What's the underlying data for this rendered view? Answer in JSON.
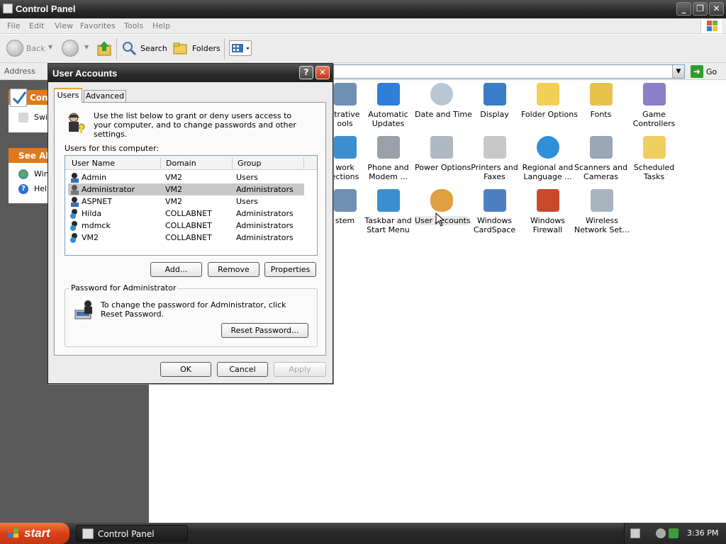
{
  "window": {
    "title": "Control Panel",
    "controls": {
      "minimize": "_",
      "restore": "❐",
      "close": "✕"
    }
  },
  "menubar": [
    "File",
    "Edit",
    "View",
    "Favorites",
    "Tools",
    "Help"
  ],
  "toolbar": {
    "back": "Back",
    "search": "Search",
    "folders": "Folders"
  },
  "addressbar": {
    "label": "Address",
    "value": "",
    "go": "Go"
  },
  "left_pane": {
    "panel_header": "Con",
    "panel_items": [
      {
        "label": "Swi",
        "icon": "switch-view-icon"
      }
    ],
    "see_also_header": "See Als",
    "see_also_items": [
      {
        "label": "Win",
        "icon": "windows-update-icon"
      },
      {
        "label": "Help",
        "icon": "help-icon"
      }
    ]
  },
  "icons": [
    {
      "label": "Administrative Tools",
      "visible": "strative\nools",
      "icon": "admin-tools-icon",
      "color": "#6f8fb3"
    },
    {
      "label": "Automatic Updates",
      "visible": "Automatic\nUpdates",
      "icon": "windows-logo-icon",
      "color": "#2f7fd8"
    },
    {
      "label": "Date and Time",
      "visible": "Date and Time",
      "icon": "clock-icon",
      "color": "#b9c6d6"
    },
    {
      "label": "Display",
      "visible": "Display",
      "icon": "monitor-icon",
      "color": "#3b7dc8"
    },
    {
      "label": "Folder Options",
      "visible": "Folder Options",
      "icon": "folder-icon",
      "color": "#f2cf55"
    },
    {
      "label": "Fonts",
      "visible": "Fonts",
      "icon": "fonts-folder-icon",
      "color": "#e8c14a"
    },
    {
      "label": "Game Controllers",
      "visible": "Game\nControllers",
      "icon": "gamepad-icon",
      "color": "#8a7fc8"
    },
    {
      "label": "Network Connections",
      "visible": "work\nections",
      "icon": "network-icon",
      "color": "#3b8fd0"
    },
    {
      "label": "Phone and Modem ...",
      "visible": "Phone and\nModem ...",
      "icon": "phone-icon",
      "color": "#9aa0a8"
    },
    {
      "label": "Power Options",
      "visible": "Power Options",
      "icon": "power-icon",
      "color": "#b0b8c4"
    },
    {
      "label": "Printers and Faxes",
      "visible": "Printers and\nFaxes",
      "icon": "printer-icon",
      "color": "#c8c8c8"
    },
    {
      "label": "Regional and Language ...",
      "visible": "Regional and\nLanguage ...",
      "icon": "globe-icon",
      "color": "#2f8fd8"
    },
    {
      "label": "Scanners and Cameras",
      "visible": "Scanners and\nCameras",
      "icon": "scanner-icon",
      "color": "#9aa7b4"
    },
    {
      "label": "Scheduled Tasks",
      "visible": "Scheduled\nTasks",
      "icon": "scheduled-folder-icon",
      "color": "#f0cf60"
    },
    {
      "label": "System",
      "visible": "stem",
      "icon": "system-icon",
      "color": "#6f8fb3"
    },
    {
      "label": "Taskbar and Start Menu",
      "visible": "Taskbar and\nStart Menu",
      "icon": "taskbar-icon",
      "color": "#3b8fd0"
    },
    {
      "label": "User Accounts",
      "visible": "User Accounts",
      "icon": "users-icon",
      "color": "#e0a040"
    },
    {
      "label": "Windows CardSpace",
      "visible": "Windows\nCardSpace",
      "icon": "cardspace-icon",
      "color": "#4f7fc0"
    },
    {
      "label": "Windows Firewall",
      "visible": "Windows\nFirewall",
      "icon": "firewall-icon",
      "color": "#c84a2a"
    },
    {
      "label": "Wireless Network Set...",
      "visible": "Wireless\nNetwork Set...",
      "icon": "wireless-icon",
      "color": "#a8b4c0"
    }
  ],
  "dialog": {
    "title": "User Accounts",
    "help": "?",
    "close": "✕",
    "tabs": [
      "Users",
      "Advanced"
    ],
    "info": "Use the list below to grant or deny users access to your computer, and to change passwords and other settings.",
    "users_label": "Users for this computer:",
    "columns": [
      "User Name",
      "Domain",
      "Group"
    ],
    "users": [
      {
        "name": "Admin",
        "domain": "VM2",
        "group": "Users"
      },
      {
        "name": "Administrator",
        "domain": "VM2",
        "group": "Administrators",
        "selected": true
      },
      {
        "name": "ASPNET",
        "domain": "VM2",
        "group": "Users"
      },
      {
        "name": "Hilda",
        "domain": "COLLABNET",
        "group": "Administrators"
      },
      {
        "name": "mdmck",
        "domain": "COLLABNET",
        "group": "Administrators"
      },
      {
        "name": "VM2",
        "domain": "COLLABNET",
        "group": "Administrators"
      }
    ],
    "buttons": {
      "add": "Add...",
      "remove": "Remove",
      "properties": "Properties"
    },
    "password_group": "Password for Administrator",
    "password_text": "To change the password for Administrator, click Reset Password.",
    "reset_button": "Reset Password...",
    "ok": "OK",
    "cancel": "Cancel",
    "apply": "Apply"
  },
  "taskbar": {
    "start": "start",
    "task": "Control Panel",
    "clock": "3:36 PM"
  }
}
